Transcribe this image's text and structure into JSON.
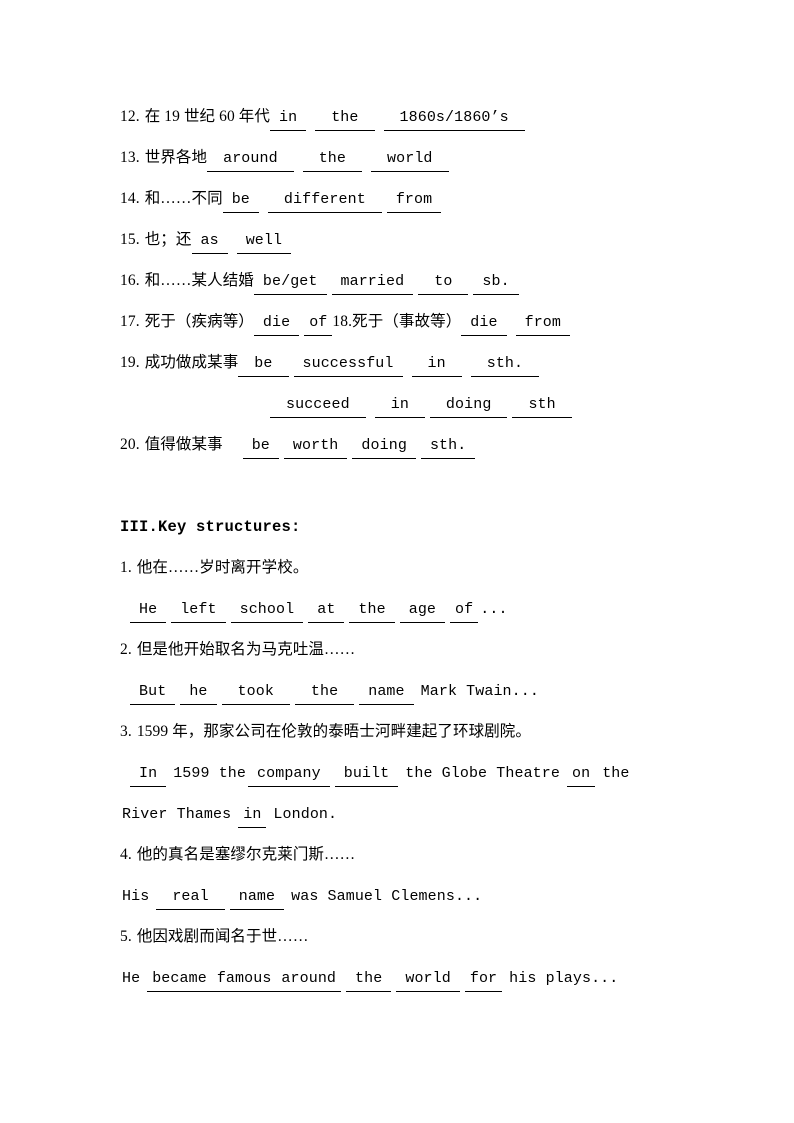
{
  "document": {
    "page_background": "#ffffff",
    "text_color": "#000000"
  },
  "phrases_section": {
    "items": [
      {
        "number": "12.",
        "prompt": "在 19 世纪 60 年代",
        "blanks": [
          "in",
          "the",
          "1860s/1860’s"
        ]
      },
      {
        "number": "13.",
        "prompt": "世界各地",
        "blanks": [
          "around",
          "the",
          "world"
        ]
      },
      {
        "number": "14.",
        "prompt": "和……不同",
        "blanks": [
          "be",
          "different",
          "from"
        ]
      },
      {
        "number": "15.",
        "prompt": "也；还",
        "blanks": [
          "as",
          "well"
        ]
      },
      {
        "number": "16.",
        "prompt": "和……某人结婚",
        "blanks": [
          "be/get",
          "married",
          "to",
          "sb."
        ]
      },
      {
        "number": "17.",
        "prompt": "死于（疾病等）",
        "blanks": [
          "die",
          "of"
        ],
        "number_b": "18.",
        "prompt_b": "死于（事故等）",
        "blanks_b": [
          "die",
          "from"
        ]
      },
      {
        "number": "19.",
        "prompt": "成功做成某事",
        "blanks": [
          "be",
          "successful",
          "in",
          "sth."
        ],
        "blanks_line2": [
          "succeed",
          "in",
          "doing",
          "sth"
        ]
      },
      {
        "number": "20.",
        "prompt": "值得做某事",
        "blanks": [
          "be",
          "worth",
          "doing",
          "sth."
        ]
      }
    ]
  },
  "key_structures": {
    "heading": "III.Key structures:",
    "items": [
      {
        "number": "1.",
        "prompt": "他在……岁时离开学校。",
        "answer_parts": [
          {
            "text": "He",
            "blank": true
          },
          {
            "text": "left",
            "blank": true
          },
          {
            "text": "school",
            "blank": true
          },
          {
            "text": "at",
            "blank": true
          },
          {
            "text": "the",
            "blank": true
          },
          {
            "text": "age",
            "blank": true
          },
          {
            "text": "of",
            "blank": true
          },
          {
            "text": "...",
            "blank": false
          }
        ]
      },
      {
        "number": "2.",
        "prompt": "但是他开始取名为马克吐温……",
        "answer_parts": [
          {
            "text": "But",
            "blank": true
          },
          {
            "text": "he",
            "blank": true
          },
          {
            "text": "took",
            "blank": true
          },
          {
            "text": "the",
            "blank": true
          },
          {
            "text": "name",
            "blank": true
          },
          {
            "text": "Mark Twain...",
            "blank": false
          }
        ]
      },
      {
        "number": "3.",
        "prompt": "1599 年，那家公司在伦敦的泰晤士河畔建起了环球剧院。",
        "answer_parts": [
          {
            "text": "In",
            "blank": true
          },
          {
            "text": "1599 the",
            "blank": false
          },
          {
            "text": "company",
            "blank": true
          },
          {
            "text": "built",
            "blank": true
          },
          {
            "text": "the Globe Theatre",
            "blank": false
          },
          {
            "text": "on",
            "blank": true
          },
          {
            "text": "the",
            "blank": false
          }
        ],
        "answer_parts_line2": [
          {
            "text": "River Thames",
            "blank": false
          },
          {
            "text": "in",
            "blank": true
          },
          {
            "text": "London.",
            "blank": false
          }
        ]
      },
      {
        "number": "4.",
        "prompt": "他的真名是塞缪尔克莱门斯……",
        "answer_parts": [
          {
            "text": "His",
            "blank": false
          },
          {
            "text": "real",
            "blank": true
          },
          {
            "text": "name",
            "blank": true
          },
          {
            "text": "was Samuel Clemens...",
            "blank": false
          }
        ]
      },
      {
        "number": "5.",
        "prompt": "他因戏剧而闻名于世……",
        "answer_parts": [
          {
            "text": "He",
            "blank": false
          },
          {
            "text": "became",
            "blank": true
          },
          {
            "text": "famous",
            "blank": true
          },
          {
            "text": "around",
            "blank": true
          },
          {
            "text": "the",
            "blank": true
          },
          {
            "text": "world",
            "blank": true
          },
          {
            "text": "for",
            "blank": true
          },
          {
            "text": "his plays...",
            "blank": false
          }
        ]
      }
    ]
  }
}
